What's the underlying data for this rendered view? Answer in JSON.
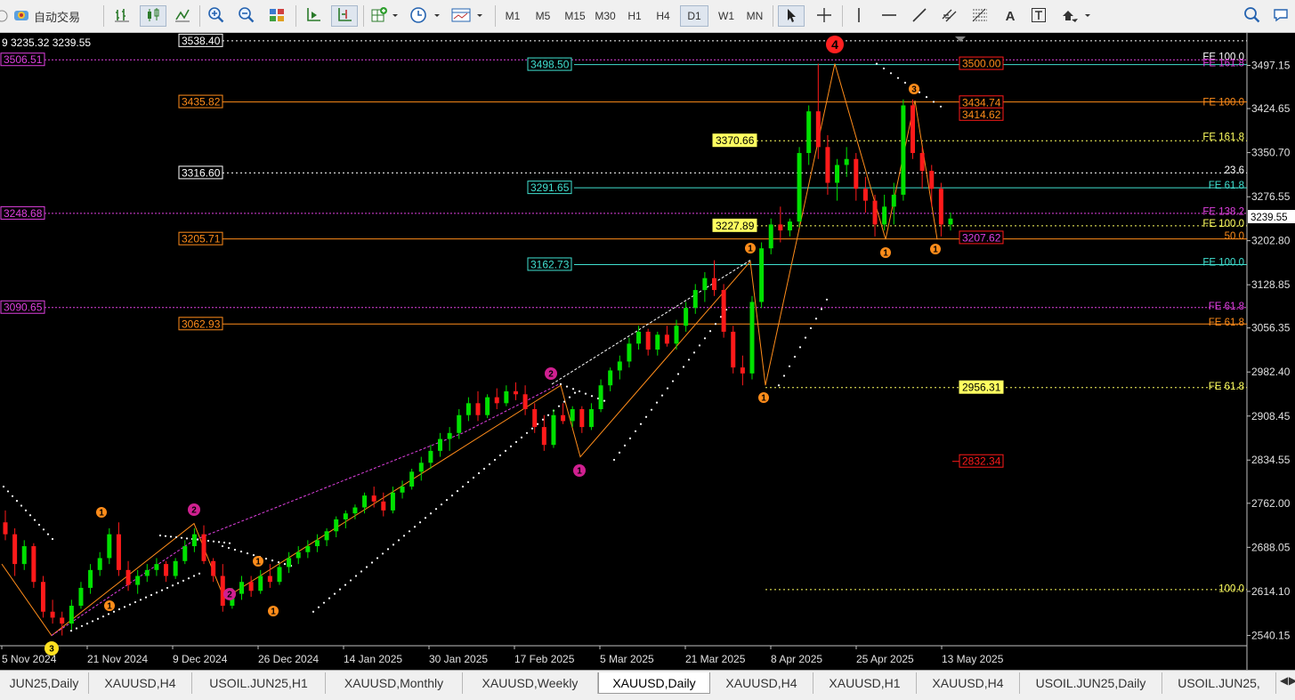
{
  "toolbar": {
    "autotrade_label": "自动交易",
    "timeframes": [
      "M1",
      "M5",
      "M15",
      "M30",
      "H1",
      "H4",
      "D1",
      "W1",
      "MN"
    ],
    "active_timeframe": "D1"
  },
  "chart": {
    "symbol_info": "9 3235.32 3239.55",
    "current_price": "3239.55",
    "price_scale": [
      "3497.15",
      "3424.65",
      "3350.70",
      "3276.55",
      "3202.80",
      "3128.85",
      "3056.35",
      "2982.40",
      "2908.45",
      "2834.55",
      "2762.00",
      "2688.05",
      "2614.10",
      "2540.15"
    ],
    "date_labels": [
      "5 Nov 2024",
      "21 Nov 2024",
      "9 Dec 2024",
      "26 Dec 2024",
      "14 Jan 2025",
      "30 Jan 2025",
      "17 Feb 2025",
      "5 Mar 2025",
      "21 Mar 2025",
      "8 Apr 2025",
      "25 Apr 2025",
      "13 May 2025"
    ],
    "level_labels": [
      "3538.40",
      "3506.51",
      "3498.50",
      "3435.82",
      "3370.66",
      "3316.60",
      "3291.65",
      "3248.68",
      "3227.89",
      "3205.71",
      "3162.73",
      "3090.65",
      "3062.93",
      "2956.31",
      "2832.34",
      "3500.00",
      "3434.74",
      "3414.62",
      "3207.62"
    ],
    "fib_labels": [
      "FE 100.0",
      "FE 161.8",
      "FE 100.0",
      "FE 161.8",
      "23.6",
      "FE 61.8",
      "FE 138.2",
      "FE 100.0",
      "50.0",
      "FE 100.0",
      "FE 61.8",
      "FE 61.8",
      "FE 61.8",
      "100.0",
      "161.8"
    ],
    "wave_labels": [
      "4",
      "1",
      "2",
      "1",
      "2",
      "1",
      "1",
      "1",
      "2",
      "2",
      "1",
      "1",
      "1",
      "1",
      "3"
    ],
    "colors": {
      "background": "#000000",
      "bull": "#00e000",
      "bear": "#ff1a1a",
      "orange_level": "#ff8c1a",
      "magenta_level": "#e040e0",
      "cyan_level": "#40e0d0",
      "yellow_level": "#ffff60",
      "white_level": "#ffffff"
    }
  },
  "tabs": [
    "JUN25,Daily",
    "XAUUSD,H4",
    "USOIL.JUN25,H1",
    "XAUUSD,Monthly",
    "XAUUSD,Weekly",
    "XAUUSD,Daily",
    "XAUUSD,H4",
    "XAUUSD,H1",
    "XAUUSD,H4",
    "USOIL.JUN25,Daily",
    "USOIL.JUN25,"
  ],
  "active_tab": "XAUUSD,Daily"
}
